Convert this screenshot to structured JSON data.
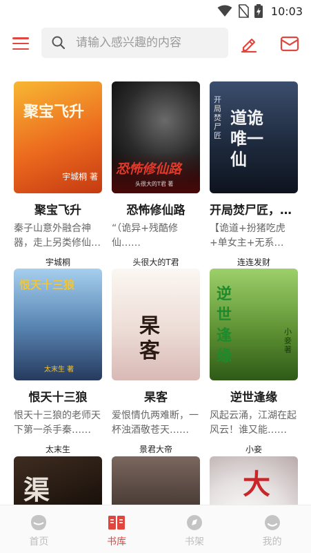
{
  "status": {
    "time": "10:03"
  },
  "search": {
    "placeholder": "请输入感兴趣的内容"
  },
  "books": [
    {
      "title": "聚宝飞升",
      "desc": "秦子山意外融合神器，走上另类修仙之路……",
      "author": "宇城桐",
      "cover_text": "聚宝飞升",
      "cover_author": "宇城桐 著",
      "colors": [
        "#f5a623",
        "#e8571c",
        "#c93a14"
      ]
    },
    {
      "title": "恐怖修仙路",
      "desc": "“（诡异+残酷修仙……",
      "author": "头很大的T君",
      "cover_text": "恐怖修仙路",
      "cover_author": "头很大的T君 著",
      "colors": [
        "#3a3a3a",
        "#1a1a1a",
        "#7a1010"
      ]
    },
    {
      "title": "开局焚尸匠，苟到天下第一",
      "desc": "【诡道+扮猪吃虎+单女主+无系统……",
      "author": "连连发财",
      "cover_text": "道诡唯一仙",
      "cover_author": "开局焚尸匠",
      "colors": [
        "#2f3f5c",
        "#1c2536",
        "#0f1620"
      ]
    },
    {
      "title": "恨天十三狼",
      "desc": "恨天十三狼的老师天下第一杀手秦……",
      "author": "太末生",
      "cover_text": "恨天十三狼",
      "cover_author": "太末生 著",
      "colors": [
        "#7db3e0",
        "#4a78a6",
        "#2b3e66"
      ]
    },
    {
      "title": "杲客",
      "desc": "爱恨情仇两难断，一杯浊酒敬苍天……",
      "author": "景君大帝",
      "cover_text": "杲客",
      "cover_author": "",
      "colors": [
        "#f6f1ec",
        "#e9d9d2",
        "#d8b9b4"
      ]
    },
    {
      "title": "逆世逢缘",
      "desc": "风起云涌，江湖在起风云！谁又能……",
      "author": "小妾",
      "cover_text": "逆世逢缘",
      "cover_author": "小妾 著",
      "colors": [
        "#8ec35a",
        "#5a8d2f",
        "#2e5a17"
      ]
    },
    {
      "title": "",
      "desc": "",
      "author": "",
      "cover_text": "渠",
      "cover_author": "",
      "colors": [
        "#3a2a1e",
        "#1a110b",
        "#5a1f10"
      ]
    },
    {
      "title": "",
      "desc": "",
      "author": "",
      "cover_text": "",
      "cover_author": "",
      "colors": [
        "#6a5850",
        "#3e312c",
        "#1e1815"
      ]
    },
    {
      "title": "",
      "desc": "",
      "author": "",
      "cover_text": "大",
      "cover_author": "",
      "colors": [
        "#f4f2f2",
        "#e2dede",
        "#b9aaaa"
      ]
    }
  ],
  "tabs": [
    {
      "label": "首页",
      "icon": "home-icon",
      "active": false
    },
    {
      "label": "书库",
      "icon": "library-icon",
      "active": true
    },
    {
      "label": "书架",
      "icon": "bookshelf-icon",
      "active": false
    },
    {
      "label": "我的",
      "icon": "profile-icon",
      "active": false
    }
  ],
  "colors": {
    "accent": "#e0463e",
    "inactive": "#bdbdbd"
  }
}
